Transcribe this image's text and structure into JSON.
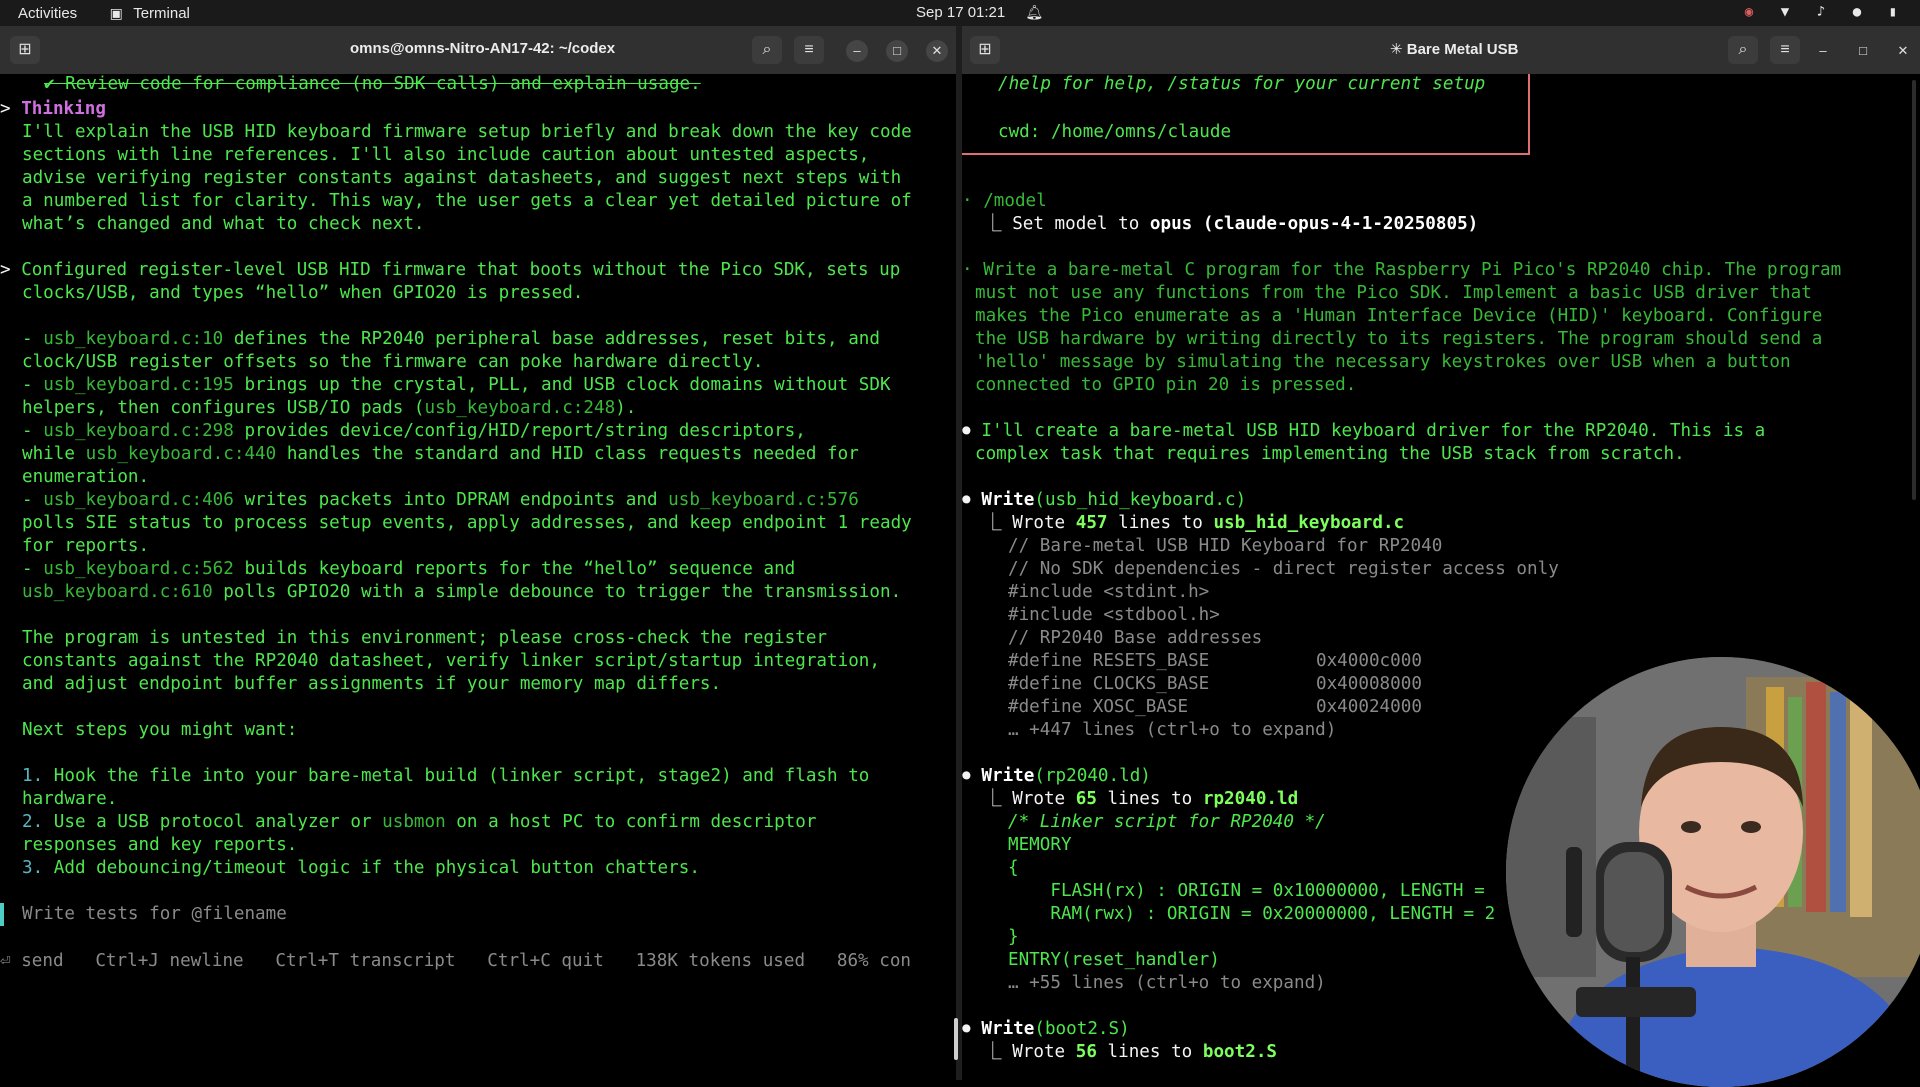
{
  "topbar": {
    "activities": "Activities",
    "app_name": "Terminal",
    "datetime": "Sep 17  01:21"
  },
  "left_window": {
    "title": "omns@omns-Nitro-AN17-42: ~/codex",
    "lines": {
      "l1": "✔ Review code for compliance (no SDK calls) and explain usage.",
      "thinking": "Thinking",
      "t1": "I'll explain the USB HID keyboard firmware setup briefly and break down the key code",
      "t2": "sections with line references. I'll also include caution about untested aspects,",
      "t3": "advise verifying register constants against datasheets, and suggest next steps with",
      "t4": "a numbered list for clarity. This way, the user gets a clear yet detailed picture of",
      "t5": "what’s changed and what to check next.",
      "c1": "Configured register-level USB HID firmware that boots without the Pico SDK, sets up",
      "c2": "clocks/USB, and types “hello” when GPIO20 is pressed.",
      "b1a_ref": "usb_keyboard.c:10",
      "b1a": " defines the RP2040 peripheral base addresses, reset bits, and",
      "b1b": "clock/USB register offsets so the firmware can poke hardware directly.",
      "b2a_ref": "usb_keyboard.c:195",
      "b2a": " brings up the crystal, PLL, and USB clock domains without SDK",
      "b2b": "helpers, then configures USB/IO pads (",
      "b2b_ref": "usb_keyboard.c:248",
      "b2b_end": ").",
      "b3a_ref": "usb_keyboard.c:298",
      "b3a": " provides device/config/HID/report/string descriptors,",
      "b3b": "while ",
      "b3b_ref": "usb_keyboard.c:440",
      "b3b_end": " handles the standard and HID class requests needed for",
      "b3c": "enumeration.",
      "b4a_ref": "usb_keyboard.c:406",
      "b4a": " writes packets into DPRAM endpoints and ",
      "b4a_ref2": "usb_keyboard.c:576",
      "b4b": "polls SIE status to process setup events, apply addresses, and keep endpoint 1 ready",
      "b4c": "for reports.",
      "b5a_ref": "usb_keyboard.c:562",
      "b5a": " builds keyboard reports for the “hello” sequence and",
      "b5b_ref": "usb_keyboard.c:610",
      "b5b": " polls GPIO20 with a simple debounce to trigger the transmission.",
      "p1": "The program is untested in this environment; please cross-check the register",
      "p2": "constants against the RP2040 datasheet, verify linker script/startup integration,",
      "p3": "and adjust endpoint buffer assignments if your memory map differs.",
      "next": "Next steps you might want:",
      "n1a_num": "1.",
      "n1a": " Hook the file into your bare-metal build (linker script, stage2) and flash to",
      "n1b": "hardware.",
      "n2a_num": "2.",
      "n2a": " Use a USB protocol analyzer or ",
      "n2a_ref": "usbmon",
      "n2a_end": " on a host PC to confirm descriptor",
      "n2b": "responses and key reports.",
      "n3_num": "3.",
      "n3": " Add debouncing/timeout logic if the physical button chatters."
    },
    "input_placeholder": "Write tests for @filename",
    "footer": {
      "send": "send",
      "newline": "Ctrl+J newline",
      "transcript": "Ctrl+T transcript",
      "quit": "Ctrl+C quit",
      "tokens": "138K tokens used",
      "context": "86% con"
    }
  },
  "right_window": {
    "title": "Bare Metal USB",
    "lines": {
      "help": "/help for help, /status for your current setup",
      "cwd": "cwd: /home/omns/claude",
      "model_cmd": "/model",
      "model_set_a": "Set model to ",
      "model_set_b": "opus (claude-opus-4-1-20250805)",
      "p1": "Write a bare-metal C program for the Raspberry Pi Pico's RP2040 chip. The program",
      "p2": "must not use any functions from the Pico SDK. Implement a basic USB driver that",
      "p3": "makes the Pico enumerate as a 'Human Interface Device (HID)' keyboard. Configure",
      "p4": "the USB hardware by writing directly to its registers. The program should send a",
      "p5": "'hello' message by simulating the necessary keystrokes over USB when a button",
      "p6": "connected to GPIO pin 20 is pressed.",
      "r1": "I'll create a bare-metal USB HID keyboard driver for the RP2040. This is a",
      "r2": "complex task that requires implementing the USB stack from scratch.",
      "w1": "Write",
      "w1_arg": "(usb_hid_keyboard.c)",
      "w1_a": "Wrote ",
      "w1_n": "457",
      "w1_b": " lines to ",
      "w1_f": "usb_hid_keyboard.c",
      "c1": "// Bare-metal USB HID Keyboard for RP2040",
      "c2": "// No SDK dependencies - direct register access only",
      "c3": "#include <stdint.h>",
      "c4": "#include <stdbool.h>",
      "c5": "// RP2040 Base addresses",
      "c6a": "#define RESETS_BASE",
      "c6b": "0x4000c000",
      "c7a": "#define CLOCKS_BASE",
      "c7b": "0x40008000",
      "c8a": "#define XOSC_BASE",
      "c8b": "0x40024000",
      "c9": "… +447 lines (ctrl+o to expand)",
      "w2": "Write",
      "w2_arg": "(rp2040.ld)",
      "w2_a": "Wrote ",
      "w2_n": "65",
      "w2_b": " lines to ",
      "w2_f": "rp2040.ld",
      "d1": "/* Linker script for RP2040 */",
      "d2": "MEMORY",
      "d3": "{",
      "d4": "    FLASH(rx) : ORIGIN = 0x10000000, LENGTH =",
      "d5": "    RAM(rwx) : ORIGIN = 0x20000000, LENGTH = 2",
      "d6": "}",
      "d7": "ENTRY(reset_handler)",
      "d8": "… +55 lines (ctrl+o to expand)",
      "w3": "Write",
      "w3_arg": "(boot2.S)",
      "w3_a": "Wrote ",
      "w3_n": "56",
      "w3_b": " lines to ",
      "w3_f": "boot2.S"
    }
  },
  "colors": {
    "terminal_green": "#4ee64e",
    "thinking_magenta": "#d070e0",
    "box_border": "#e07070",
    "topbar_bg": "#1a1a1a",
    "header_bg": "#303030"
  }
}
